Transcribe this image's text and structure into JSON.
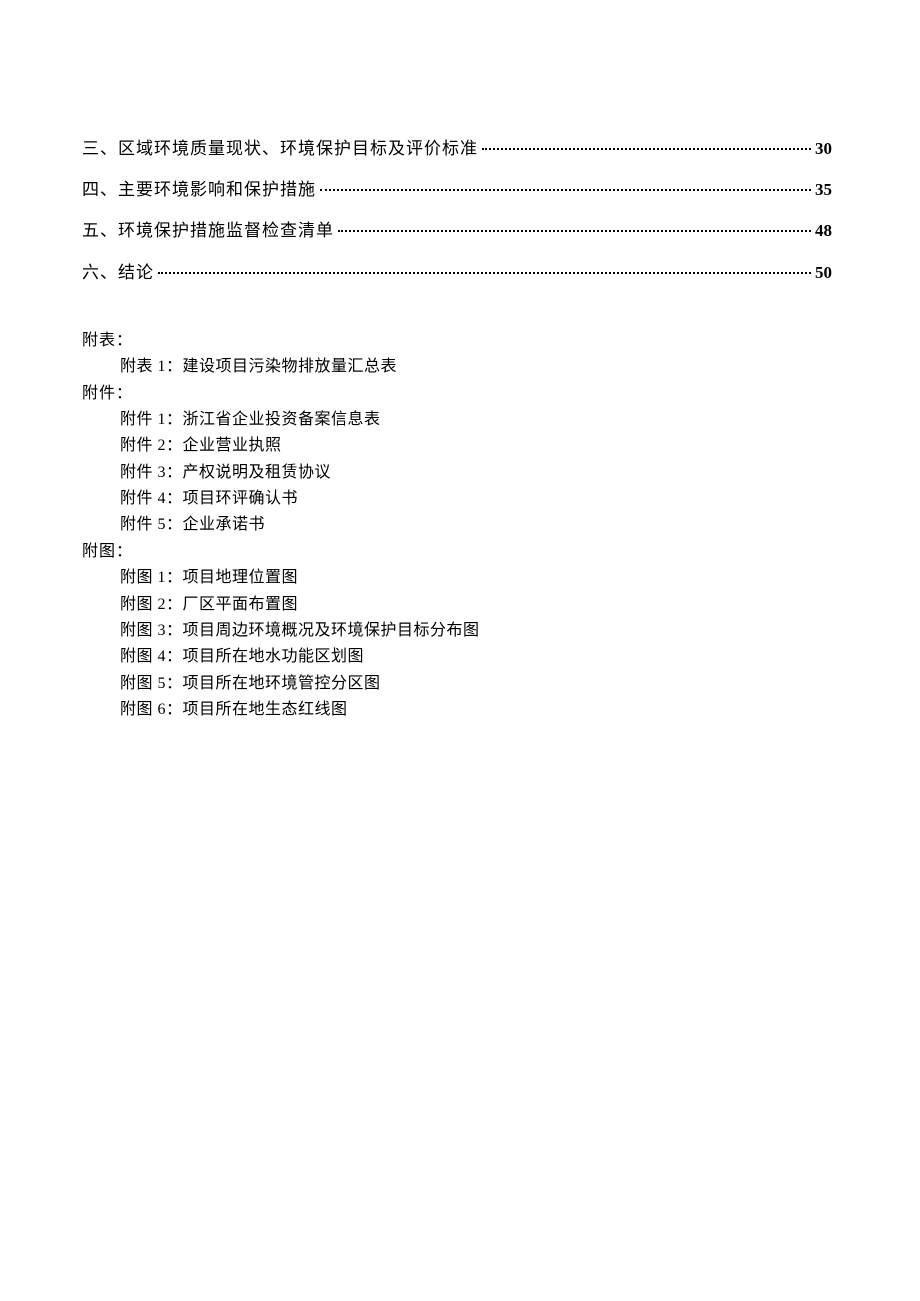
{
  "toc": [
    {
      "title": "三、区域环境质量现状、环境保护目标及评价标准",
      "page": "30"
    },
    {
      "title": "四、主要环境影响和保护措施",
      "page": "35"
    },
    {
      "title": "五、环境保护措施监督检查清单",
      "page": "48"
    },
    {
      "title": "六、结论",
      "page": "50"
    }
  ],
  "sections": {
    "tables": {
      "header": "附表：",
      "items": [
        {
          "label": "附表 1：建设项目污染物排放量汇总表"
        }
      ]
    },
    "attachments": {
      "header": "附件：",
      "items": [
        {
          "label": "附件 1：浙江省企业投资备案信息表"
        },
        {
          "label": "附件 2：企业营业执照"
        },
        {
          "label": "附件 3：产权说明及租赁协议"
        },
        {
          "label": "附件 4：项目环评确认书"
        },
        {
          "label": "附件 5：企业承诺书"
        }
      ]
    },
    "figures": {
      "header": "附图：",
      "items": [
        {
          "label": "附图 1：项目地理位置图"
        },
        {
          "label": "附图 2：厂区平面布置图"
        },
        {
          "label": "附图 3：项目周边环境概况及环境保护目标分布图"
        },
        {
          "label": "附图 4：项目所在地水功能区划图"
        },
        {
          "label": "附图 5：项目所在地环境管控分区图"
        },
        {
          "label": "附图 6：项目所在地生态红线图"
        }
      ]
    }
  }
}
